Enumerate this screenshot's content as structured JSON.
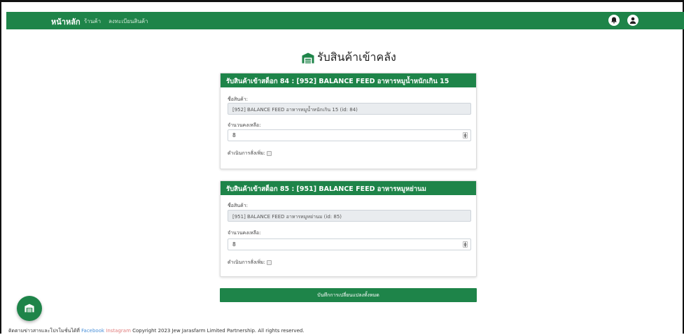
{
  "navbar": {
    "brand": "หน้าหลัก",
    "links": [
      "ร้านค้า",
      "ลงทะเบียนสินค้า"
    ],
    "icons": [
      "bell-icon",
      "user-icon"
    ],
    "color": "#1e8449"
  },
  "page": {
    "title": "รับสินค้าเข้าคลัง",
    "title_icon": "warehouse-icon"
  },
  "cards": [
    {
      "header": "รับสินค้าเข้าสต็อก 84 : [952] BALANCE FEED อาหารหมูน้ำหนักเกิน 15",
      "product_label": "ชื่อสินค้า:",
      "product_value": "[952] BALANCE FEED อาหารหมูน้ำหนักเกิน 15 (id: 84)",
      "qty_label": "จำนวนคงเหลือ:",
      "qty_value": "8",
      "reorder_label": "ดำเนินการสั่งเพิ่ม:",
      "reorder_checked": false
    },
    {
      "header": "รับสินค้าเข้าสต็อก 85 : [951] BALANCE FEED อาหารหมูหย่านม",
      "product_label": "ชื่อสินค้า:",
      "product_value": "[951] BALANCE FEED อาหารหมูหย่านม (id: 85)",
      "qty_label": "จำนวนคงเหลือ:",
      "qty_value": "8",
      "reorder_label": "ดำเนินการสั่งเพิ่ม:",
      "reorder_checked": false
    }
  ],
  "save_button": "บันทึกการเปลี่ยนแปลงทั้งหมด",
  "fab_icon": "warehouse-icon",
  "footer": {
    "contact": "ติดตามข่าวสารและโปรโมชั่นได้ที่ Facebook",
    "facebook": "Facebook",
    "instagram": "Instagram",
    "copyright": "Copyright 2023 Jew Jarasfarm Limited Partnership. All rights reserved."
  }
}
